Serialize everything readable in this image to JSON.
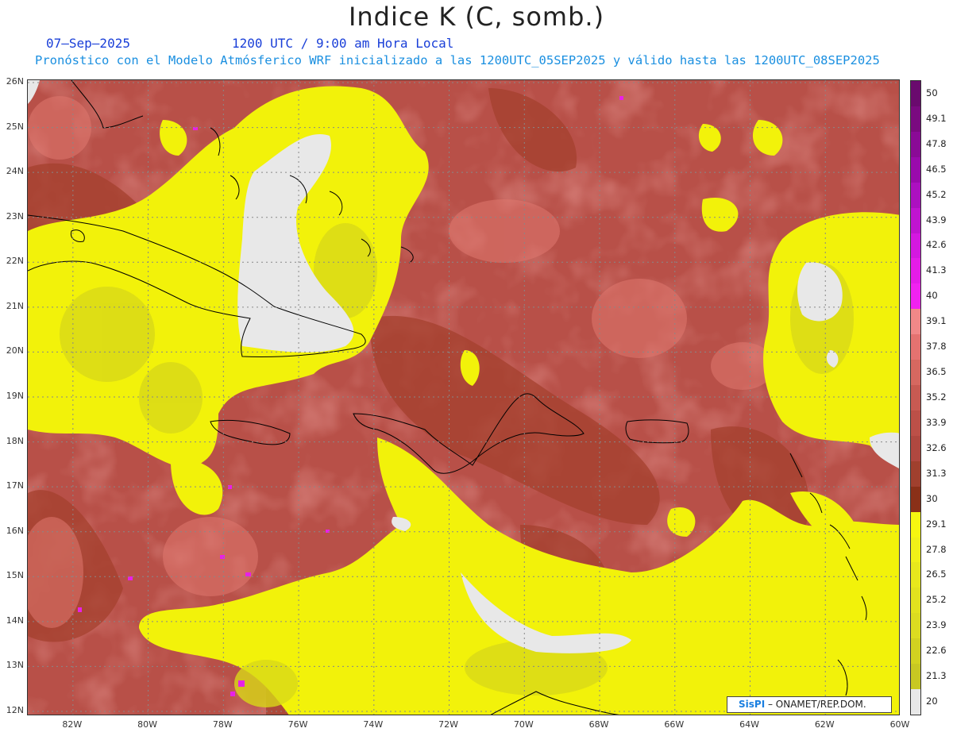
{
  "title": "Indice K (C, somb.)",
  "header": {
    "date": "07–Sep–2025",
    "time": "1200 UTC / 9:00 am Hora Local",
    "description": "Pronóstico con el Modelo Atmósferico WRF inicializado a las 1200UTC_05SEP2025 y válido hasta las  1200UTC_08SEP2025"
  },
  "map": {
    "lat_labels": [
      "26N",
      "25N",
      "24N",
      "23N",
      "22N",
      "21N",
      "20N",
      "19N",
      "18N",
      "17N",
      "16N",
      "15N",
      "14N",
      "13N",
      "12N"
    ],
    "lon_labels": [
      "82W",
      "80W",
      "78W",
      "76W",
      "74W",
      "72W",
      "70W",
      "68W",
      "66W",
      "64W",
      "62W",
      "60W"
    ],
    "lat_range": [
      12,
      26
    ],
    "lon_range": [
      -83.2,
      -60
    ],
    "colors": {
      "dominant": "#b85048",
      "yellow": "#f2f20a",
      "olive": "#d8d818",
      "gray": "#e8e8e8"
    }
  },
  "colorbar": {
    "labels": [
      "50",
      "49.1",
      "47.8",
      "46.5",
      "45.2",
      "43.9",
      "42.6",
      "41.3",
      "40",
      "39.1",
      "37.8",
      "36.5",
      "35.2",
      "33.9",
      "32.6",
      "31.3",
      "30",
      "29.1",
      "27.8",
      "26.5",
      "25.2",
      "23.9",
      "22.6",
      "21.3",
      "20"
    ],
    "colors": [
      "#6a0a6e",
      "#7a0a80",
      "#8a0a96",
      "#9a0aac",
      "#ac10c0",
      "#c014d0",
      "#d418e0",
      "#e41ce8",
      "#f022f0",
      "#f08888",
      "#e47270",
      "#d66860",
      "#c85a52",
      "#bc5048",
      "#b04840",
      "#a0402e",
      "#8a3018",
      "#f6f610",
      "#f0f018",
      "#e8e81c",
      "#e2e21e",
      "#dcdc20",
      "#d2d220",
      "#c8c822",
      "#e8e8e8"
    ]
  },
  "credit": {
    "logo": "SisPI",
    "text": " –  ONAMET/REP.DOM."
  }
}
